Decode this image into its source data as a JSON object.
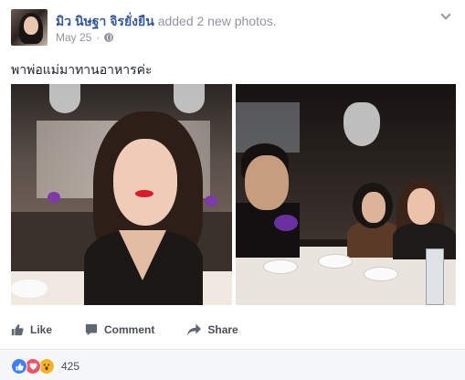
{
  "post": {
    "author_name": "มิว นิษฐา จิรยั่งยืน",
    "action_text": "added 2 new photos.",
    "date": "May 25",
    "meta_separator": "·",
    "caption": "พาพ่อแม่มาทานอาหารค่ะ",
    "privacy_icon": "globe-icon",
    "menu_icon": "chevron-down-icon"
  },
  "photos": [
    {
      "name": "photo-woman-at-restaurant"
    },
    {
      "name": "photo-family-at-dinner-table"
    }
  ],
  "actions": {
    "like_label": "Like",
    "comment_label": "Comment",
    "share_label": "Share"
  },
  "reactions": {
    "icons": [
      "like-reaction-icon",
      "love-reaction-icon",
      "wow-reaction-icon"
    ],
    "count": "425"
  },
  "colors": {
    "link": "#365899",
    "secondary_text": "#90949c",
    "action_text": "#4b4f56",
    "like_blue": "#4080ff",
    "love_red": "#f25268",
    "wow_yellow": "#f7b125"
  }
}
